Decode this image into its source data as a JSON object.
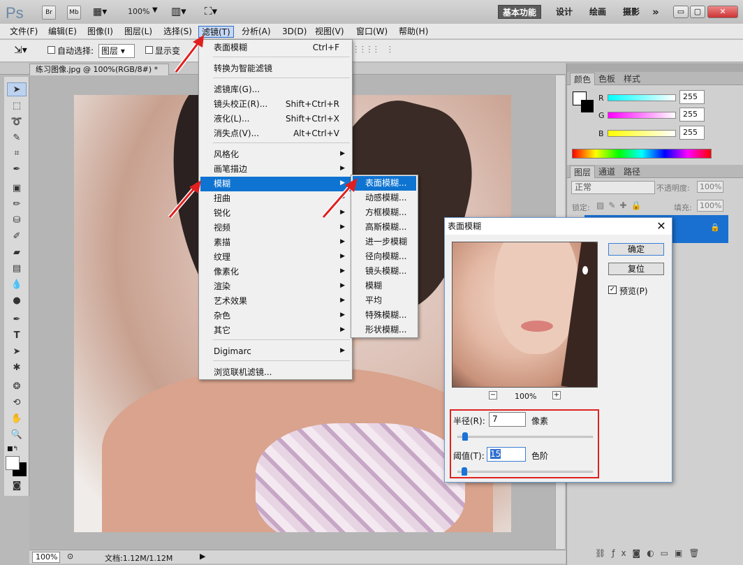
{
  "app": {
    "logo": "Ps",
    "bridge": "Br",
    "minibridge": "Mb",
    "zoom": "100%"
  },
  "workspaces": {
    "active": "基本功能",
    "design": "设计",
    "painting": "绘画",
    "photography": "摄影",
    "more": "»"
  },
  "window_buttons": {
    "min": "▭",
    "max": "▢",
    "close": "✕"
  },
  "menubar": [
    "文件(F)",
    "编辑(E)",
    "图像(I)",
    "图层(L)",
    "选择(S)",
    "滤镜(T)",
    "分析(A)",
    "3D(D)",
    "视图(V)",
    "窗口(W)",
    "帮助(H)"
  ],
  "options": {
    "auto_select_label": "自动选择:",
    "auto_select_value": "图层",
    "show_transform": "显示变"
  },
  "document": {
    "tab_title": "练习图像.jpg @ 100%(RGB/8#) *",
    "status_zoom": "100%",
    "status_doc": "文档:1.12M/1.12M"
  },
  "filter_menu": {
    "items": [
      {
        "label": "表面模糊",
        "shortcut": "Ctrl+F"
      },
      {
        "label": "转换为智能滤镜",
        "shortcut": ""
      },
      {
        "label": "滤镜库(G)...",
        "shortcut": ""
      },
      {
        "label": "镜头校正(R)...",
        "shortcut": "Shift+Ctrl+R"
      },
      {
        "label": "液化(L)...",
        "shortcut": "Shift+Ctrl+X"
      },
      {
        "label": "消失点(V)...",
        "shortcut": "Alt+Ctrl+V"
      },
      {
        "label": "风格化",
        "shortcut": ""
      },
      {
        "label": "画笔描边",
        "shortcut": ""
      },
      {
        "label": "模糊",
        "shortcut": ""
      },
      {
        "label": "扭曲",
        "shortcut": ""
      },
      {
        "label": "锐化",
        "shortcut": ""
      },
      {
        "label": "视频",
        "shortcut": ""
      },
      {
        "label": "素描",
        "shortcut": ""
      },
      {
        "label": "纹理",
        "shortcut": ""
      },
      {
        "label": "像素化",
        "shortcut": ""
      },
      {
        "label": "渲染",
        "shortcut": ""
      },
      {
        "label": "艺术效果",
        "shortcut": ""
      },
      {
        "label": "杂色",
        "shortcut": ""
      },
      {
        "label": "其它",
        "shortcut": ""
      },
      {
        "label": "Digimarc",
        "shortcut": ""
      },
      {
        "label": "浏览联机滤镜...",
        "shortcut": ""
      }
    ],
    "submenu_arrow": "▶",
    "highlighted": "模糊"
  },
  "blur_submenu": [
    "表面模糊...",
    "动感模糊...",
    "方框模糊...",
    "高斯模糊...",
    "进一步模糊",
    "径向模糊...",
    "镜头模糊...",
    "模糊",
    "平均",
    "特殊模糊...",
    "形状模糊..."
  ],
  "dialog": {
    "title": "表面模糊",
    "ok": "确定",
    "reset": "复位",
    "preview_label": "预览(P)",
    "preview_checked": true,
    "zoom_minus": "−",
    "zoom": "100%",
    "zoom_plus": "+",
    "radius_label": "半径(R):",
    "radius_value": "7",
    "radius_unit": "像素",
    "threshold_label": "阈值(T):",
    "threshold_value": "15",
    "threshold_unit": "色阶"
  },
  "color_panel": {
    "tabs": [
      "颜色",
      "色板",
      "样式"
    ],
    "r_label": "R",
    "g_label": "G",
    "b_label": "B",
    "r": "255",
    "g": "255",
    "b": "255"
  },
  "layers_panel": {
    "tabs": [
      "图层",
      "通道",
      "路径"
    ],
    "blend": "正常",
    "opacity_label": "不透明度:",
    "opacity": "100%",
    "lock_label": "锁定:",
    "fill_label": "填充:",
    "fill": "100%"
  },
  "accent_color": "#0f74d1",
  "highlight_box_color": "#e02020",
  "arrow_color": "#e02020"
}
